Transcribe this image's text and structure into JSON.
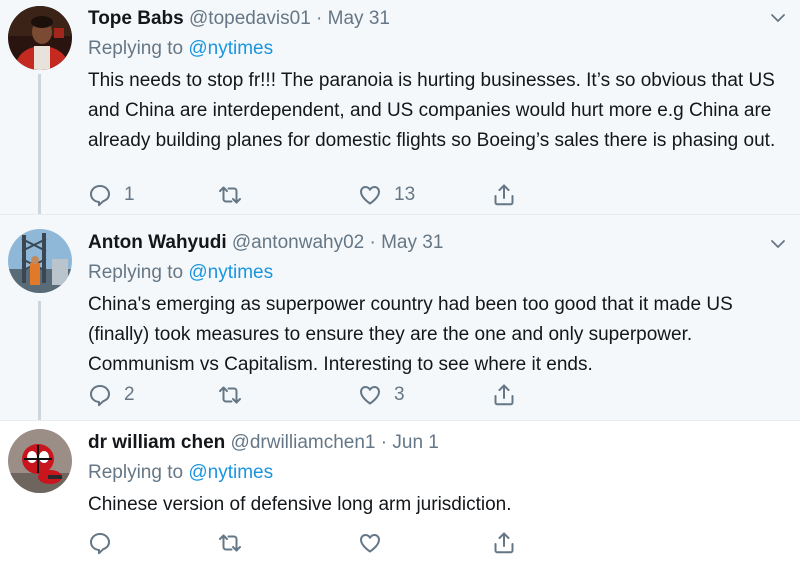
{
  "tweets": [
    {
      "name": "Tope Babs",
      "handle": "@topedavis01",
      "date": "· May 31",
      "replying_prefix": "Replying to",
      "replying_handle": "@nytimes",
      "text": "This needs to stop fr!!! The paranoia is hurting businesses. It’s so obvious that US and China are interdependent, and US companies would hurt more e.g China are already building planes for domestic flights so Boeing’s sales there is phasing out.",
      "reply_count": "1",
      "retweet_count": "",
      "like_count": "13"
    },
    {
      "name": "Anton Wahyudi",
      "handle": "@antonwahy02",
      "date": "· May 31",
      "replying_prefix": "Replying to",
      "replying_handle": "@nytimes",
      "text": "China's emerging as superpower country had been too good that it made US (finally) took measures to ensure they are the one and only superpower. Communism vs Capitalism. Interesting to see where it ends.",
      "reply_count": "2",
      "retweet_count": "",
      "like_count": "3"
    },
    {
      "name": "dr william chen",
      "handle": "@drwilliamchen1",
      "date": "· Jun 1",
      "replying_prefix": "Replying to",
      "replying_handle": "@nytimes",
      "text": "Chinese version of defensive long arm jurisdiction.",
      "reply_count": "",
      "retweet_count": "",
      "like_count": ""
    }
  ],
  "icons": {
    "reply": "reply-icon",
    "retweet": "retweet-icon",
    "like": "heart-icon",
    "share": "share-icon",
    "more": "chevron-down-icon"
  },
  "colors": {
    "link": "#1b95e0",
    "muted": "#657786",
    "text": "#14171a",
    "thread_bg": "#f5f8fa"
  }
}
